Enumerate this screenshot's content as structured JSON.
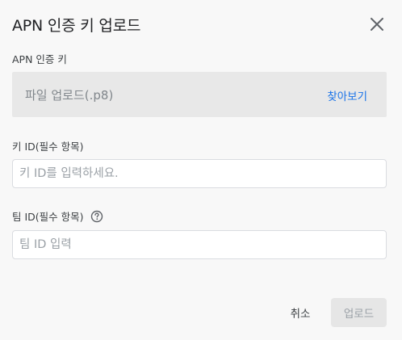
{
  "dialog": {
    "title": "APN 인증 키 업로드",
    "close_icon": "close-icon"
  },
  "apn_key": {
    "label": "APN 인증 키",
    "placeholder": "파일 업로드(.p8)",
    "browse_label": "찾아보기"
  },
  "key_id": {
    "label": "키 ID(필수 항목)",
    "placeholder": "키 ID를 입력하세요.",
    "value": ""
  },
  "team_id": {
    "label": "팀 ID(필수 항목)",
    "help_icon": "help-circle-icon",
    "placeholder": "팀 ID 입력",
    "value": ""
  },
  "actions": {
    "cancel_label": "취소",
    "upload_label": "업로드",
    "upload_enabled": false
  },
  "colors": {
    "accent": "#1a73e8",
    "background": "#f8f8f8",
    "disabled_button": "#e6e6e6"
  }
}
